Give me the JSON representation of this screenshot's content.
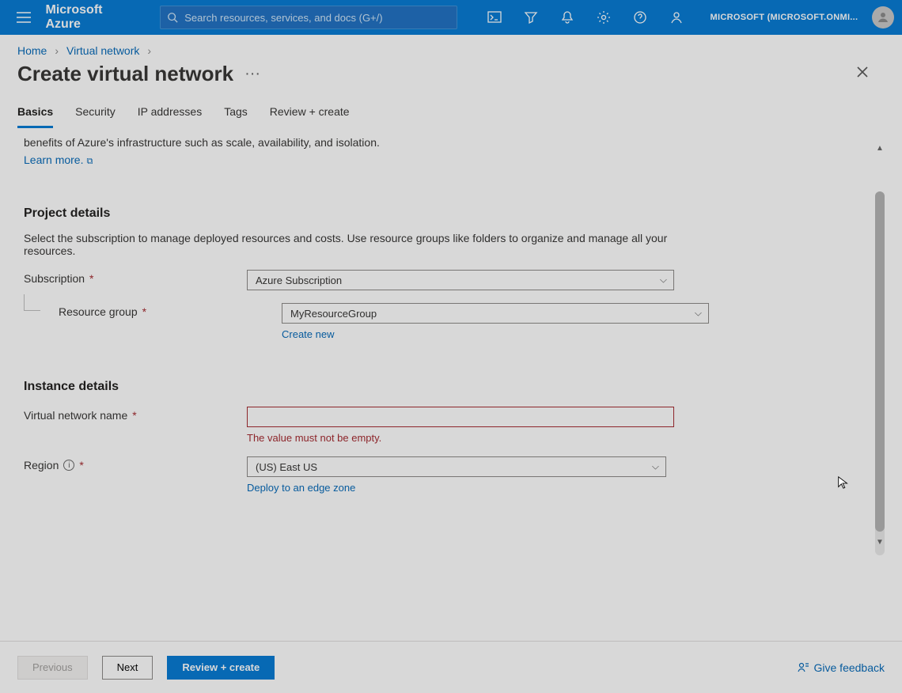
{
  "header": {
    "brand": "Microsoft Azure",
    "searchPlaceholder": "Search resources, services, and docs (G+/)",
    "tenant": "MICROSOFT (MICROSOFT.ONMI..."
  },
  "breadcrumbs": {
    "home": "Home",
    "vnet": "Virtual network"
  },
  "page": {
    "title": "Create virtual network"
  },
  "tabs": {
    "basics": "Basics",
    "security": "Security",
    "ip": "IP addresses",
    "tags": "Tags",
    "review": "Review + create"
  },
  "intro": {
    "line": "benefits of Azure's infrastructure such as scale, availability, and isolation.",
    "learnMore": "Learn more."
  },
  "project": {
    "title": "Project details",
    "text": "Select the subscription to manage deployed resources and costs. Use resource groups like folders to organize and manage all your resources.",
    "subscriptionLabel": "Subscription",
    "subscriptionValue": "Azure Subscription",
    "rgLabel": "Resource group",
    "rgValue": "MyResourceGroup",
    "createNew": "Create new"
  },
  "instance": {
    "title": "Instance details",
    "nameLabel": "Virtual network name",
    "nameValue": "",
    "nameError": "The value must not be empty.",
    "regionLabel": "Region",
    "regionValue": "(US) East US",
    "edgeLink": "Deploy to an edge zone"
  },
  "footer": {
    "previous": "Previous",
    "next": "Next",
    "review": "Review + create",
    "feedback": "Give feedback"
  }
}
